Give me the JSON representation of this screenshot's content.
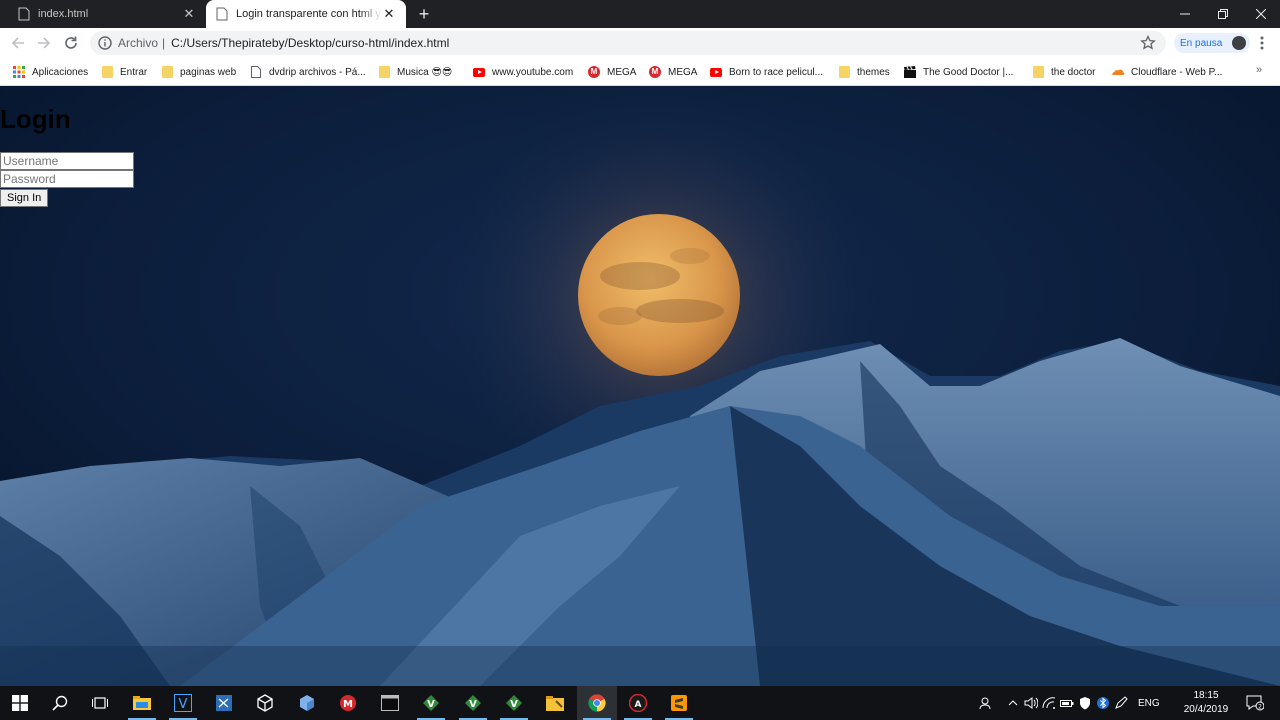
{
  "browser": {
    "tabs": [
      {
        "title": "index.html",
        "active": false
      },
      {
        "title": "Login transparente con html y css",
        "active": true
      }
    ],
    "address": {
      "scheme_label": "Archivo",
      "path": "C:/Users/Thepirateby/Desktop/curso-html/index.html"
    },
    "profile_status": "En pausa",
    "bookmarks": [
      {
        "label": "Aplicaciones",
        "icon": "apps-grid-icon"
      },
      {
        "label": "Entrar",
        "icon": "folder-icon"
      },
      {
        "label": "paginas web",
        "icon": "folder-icon"
      },
      {
        "label": "dvdrip archivos - Pá...",
        "icon": "page-icon"
      },
      {
        "label": "Musica 😎😎",
        "icon": "folder-icon"
      },
      {
        "label": "www.youtube.com",
        "icon": "youtube-icon"
      },
      {
        "label": "MEGA",
        "icon": "mega-icon"
      },
      {
        "label": "MEGA",
        "icon": "mega-icon"
      },
      {
        "label": "Born to race pelicul...",
        "icon": "youtube-icon"
      },
      {
        "label": "themes",
        "icon": "folder-icon"
      },
      {
        "label": "The Good Doctor |...",
        "icon": "clapperboard-icon"
      },
      {
        "label": "the doctor",
        "icon": "folder-icon"
      },
      {
        "label": "Cloudflare - Web P...",
        "icon": "cloudflare-icon"
      }
    ],
    "bookmarks_overflow": "»"
  },
  "page": {
    "heading": "Login",
    "username_placeholder": "Username",
    "password_placeholder": "Password",
    "submit_label": "Sign In",
    "background": "night-mountains-full-moon"
  },
  "taskbar": {
    "apps": [
      "windows-start-icon",
      "search-icon",
      "task-view-icon",
      "file-explorer-icon",
      "visual-studio-icon",
      "visual-studio-code-icon",
      "3d-box-icon",
      "cube-app-icon",
      "mega-app-icon",
      "terminal-icon",
      "vim-icon",
      "vim-icon",
      "vim-icon",
      "folder-tool-icon",
      "chrome-icon",
      "red-app-icon",
      "sublime-text-icon"
    ],
    "language": "ENG",
    "time": "18:15",
    "date": "20/4/2019",
    "notification_count": "2"
  },
  "colors": {
    "titlebar": "#202124",
    "sky": "#0b1a33",
    "moon": "#e2a04a",
    "taskbar": "#101216"
  }
}
